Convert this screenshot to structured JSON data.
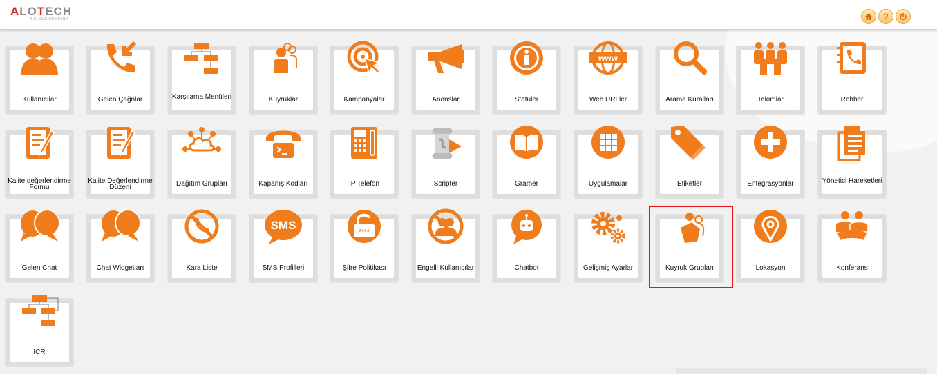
{
  "header": {
    "logo_text": "ALOTECH",
    "logo_tagline": "A CLOUD COMPANY",
    "buttons": [
      {
        "name": "home-button",
        "icon": "home-icon"
      },
      {
        "name": "help-button",
        "icon": "question-icon",
        "glyph": "?"
      },
      {
        "name": "logout-button",
        "icon": "power-icon"
      }
    ]
  },
  "colors": {
    "accent": "#f07c1b",
    "highlight": "#e4151e"
  },
  "tiles": [
    {
      "label": "Kullanıcılar",
      "icon": "users-icon"
    },
    {
      "label": "Gelen Çağnlar",
      "icon": "incoming-call-icon"
    },
    {
      "label": "Karşılama Menüleri",
      "icon": "flowchart-icon"
    },
    {
      "label": "Kuyruklar",
      "icon": "queue-people-icon"
    },
    {
      "label": "Kampanyalar",
      "icon": "target-icon"
    },
    {
      "label": "Anonslar",
      "icon": "megaphone-icon"
    },
    {
      "label": "Statüler",
      "icon": "info-icon"
    },
    {
      "label": "Web URLler",
      "icon": "www-globe-icon"
    },
    {
      "label": "Arama Kuralları",
      "icon": "search-icon"
    },
    {
      "label": "Takımlar",
      "icon": "team-icon"
    },
    {
      "label": "Rehber",
      "icon": "phonebook-icon"
    },
    {
      "label": "Kalite değerlendirme Formu",
      "icon": "form-edit-icon"
    },
    {
      "label": "Kalite Değerlendirme Düzeni",
      "icon": "form-edit-icon"
    },
    {
      "label": "Dağıtım Grupları",
      "icon": "cloud-network-icon"
    },
    {
      "label": "Kapanış Kodları",
      "icon": "hangup-phone-icon"
    },
    {
      "label": "IP Telefon",
      "icon": "ip-phone-icon"
    },
    {
      "label": "Scripter",
      "icon": "scroll-icon"
    },
    {
      "label": "Gramer",
      "icon": "book-icon"
    },
    {
      "label": "Uygulamalar",
      "icon": "apps-grid-icon"
    },
    {
      "label": "Etiketler",
      "icon": "tags-icon"
    },
    {
      "label": "Entegrasyonlar",
      "icon": "plus-circle-icon"
    },
    {
      "label": "Yönetici Hareketleri",
      "icon": "documents-icon"
    },
    {
      "label": "Gelen Chat",
      "icon": "chat-bubbles-icon"
    },
    {
      "label": "Chat Widgetları",
      "icon": "chat-bubbles-icon"
    },
    {
      "label": "Kara Liste",
      "icon": "blocked-phone-icon"
    },
    {
      "label": "SMS Profilleri",
      "icon": "sms-bubble-icon",
      "glyph": "SMS"
    },
    {
      "label": "Şifre Politikası",
      "icon": "password-lock-icon",
      "glyph": "****"
    },
    {
      "label": "Engelli Kullanıcılar",
      "icon": "blocked-users-icon"
    },
    {
      "label": "Chatbot",
      "icon": "chatbot-icon"
    },
    {
      "label": "Gelişmiş Ayarlar",
      "icon": "gears-icon"
    },
    {
      "label": "Kuyruk Grupları",
      "icon": "queue-group-icon"
    },
    {
      "label": "Lokasyon",
      "icon": "location-pin-icon"
    },
    {
      "label": "Konferans",
      "icon": "conference-icon"
    },
    {
      "label": "ICR",
      "icon": "flowchart-icon"
    }
  ]
}
